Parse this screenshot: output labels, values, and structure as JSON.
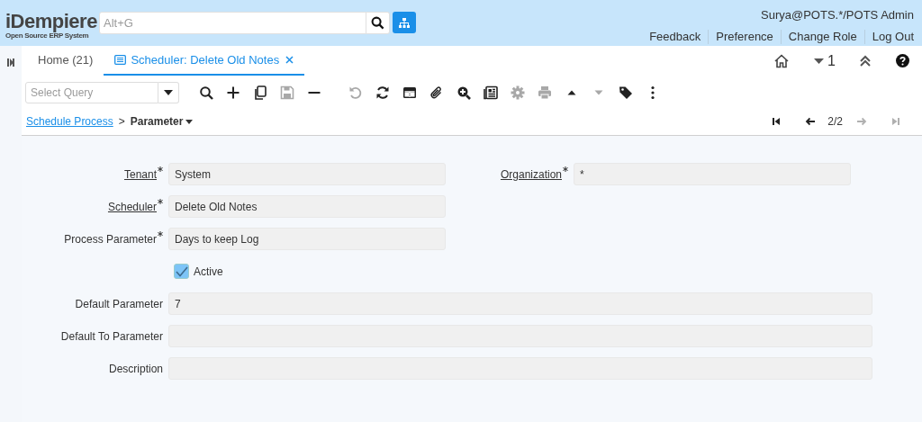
{
  "header": {
    "logo": {
      "title": "iDempiere",
      "subtitle": "Open Source ERP System"
    },
    "search": {
      "placeholder": "Alt+G"
    },
    "user": "Surya@POTS.*/POTS Admin",
    "links": [
      "Feedback",
      "Preference",
      "Change Role",
      "Log Out"
    ]
  },
  "tabs": [
    {
      "label": "Home (21)",
      "selected": false,
      "closable": false
    },
    {
      "label": "Scheduler: Delete Old Notes",
      "selected": true,
      "closable": true
    }
  ],
  "tab_tools": {
    "count": "1"
  },
  "toolbar": {
    "query": {
      "placeholder": "Select Query"
    },
    "groups": [
      [
        {
          "kind": "search",
          "disabled": false
        },
        {
          "kind": "new",
          "disabled": false
        },
        {
          "kind": "copy",
          "disabled": false
        },
        {
          "kind": "save",
          "disabled": true
        },
        {
          "kind": "delete",
          "disabled": false
        }
      ],
      [
        {
          "kind": "undo",
          "disabled": true
        },
        {
          "kind": "refresh",
          "disabled": false
        },
        {
          "kind": "grid",
          "disabled": false
        },
        {
          "kind": "attachment",
          "disabled": false
        },
        {
          "kind": "zoom",
          "disabled": false
        },
        {
          "kind": "report",
          "disabled": false
        },
        {
          "kind": "settings",
          "disabled": true
        },
        {
          "kind": "print",
          "disabled": true
        },
        {
          "kind": "up",
          "disabled": false
        },
        {
          "kind": "down",
          "disabled": true
        },
        {
          "kind": "tag",
          "disabled": false
        },
        {
          "kind": "more",
          "disabled": false
        }
      ]
    ]
  },
  "breadcrumb": {
    "parent": "Schedule Process",
    "separator": ">",
    "current": "Parameter"
  },
  "navigation": {
    "position": "2/2",
    "buttons": [
      {
        "kind": "first",
        "disabled": false
      },
      {
        "kind": "previous",
        "disabled": false
      },
      {
        "kind": "next",
        "disabled": true
      },
      {
        "kind": "last",
        "disabled": true
      }
    ]
  },
  "form": {
    "rows": [
      [
        {
          "kind": "text",
          "label": "Tenant",
          "required": true,
          "link": true,
          "value": "System",
          "wide": false
        },
        {
          "kind": "text",
          "label": "Organization",
          "required": true,
          "link": true,
          "value": "*",
          "wide": false
        }
      ],
      [
        {
          "kind": "text",
          "label": "Scheduler",
          "required": true,
          "link": true,
          "value": "Delete Old Notes",
          "wide": false
        }
      ],
      [
        {
          "kind": "text",
          "label": "Process Parameter",
          "required": true,
          "link": false,
          "value": "Days to keep Log",
          "wide": false
        }
      ],
      [
        {
          "kind": "checkbox",
          "label": "Active",
          "checked": true
        }
      ],
      [
        {
          "kind": "text",
          "label": "Default Parameter",
          "required": false,
          "link": false,
          "value": "7",
          "wide": true
        }
      ],
      [
        {
          "kind": "text",
          "label": "Default To Parameter",
          "required": false,
          "link": false,
          "wide": true
        }
      ],
      [
        {
          "kind": "text",
          "label": "Description",
          "required": false,
          "link": false,
          "wide": true
        }
      ]
    ]
  }
}
